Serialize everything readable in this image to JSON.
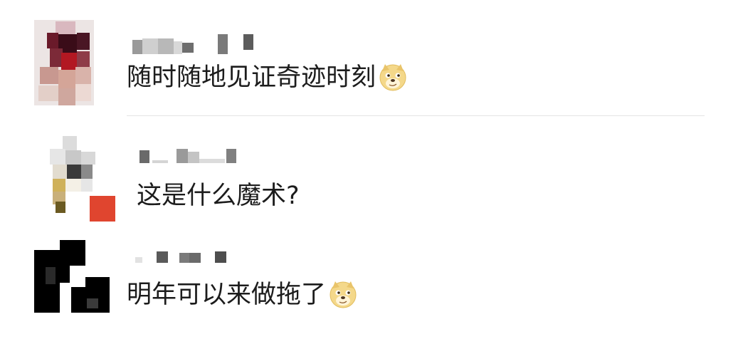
{
  "comments": [
    {
      "text": "随时随地见证奇迹时刻",
      "emoji": "doge-emoji"
    },
    {
      "text": "这是什么魔术?",
      "emoji": ""
    },
    {
      "text": "明年可以来做拖了",
      "emoji": "doge-emoji"
    }
  ]
}
